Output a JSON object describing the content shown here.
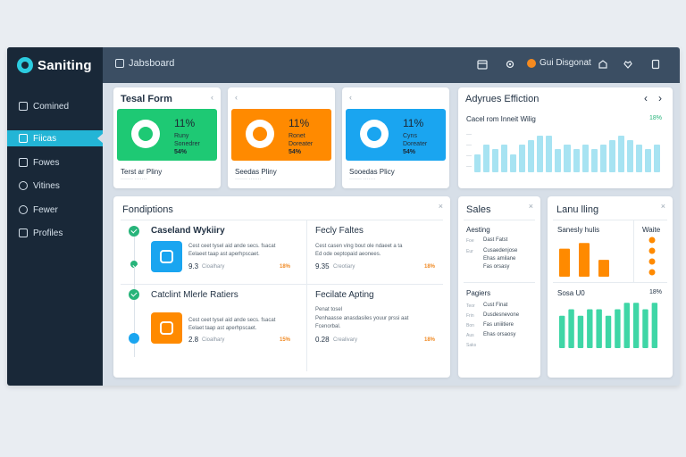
{
  "app": {
    "name": "Saniting"
  },
  "header": {
    "breadcrumb": "Jabsboard",
    "user": "Gui Disgonat"
  },
  "icons": {
    "brand": "logo-icon",
    "breadcrumb": "dashboard-icon",
    "topbar": [
      "calendar-icon",
      "settings-icon",
      "user-icon",
      "share-icon",
      "heart-icon",
      "download-icon"
    ]
  },
  "colors": {
    "accent": "#23b5d6",
    "green": "#1ec974",
    "orange": "#ff8a00",
    "blue": "#1aa5f0",
    "bar": "#a7e3f2",
    "bar_green": "#3fd6a6"
  },
  "sidebar": {
    "items": [
      {
        "label": "Comined",
        "icon": "lock-icon"
      },
      {
        "label": "Fiicas",
        "icon": "card-icon",
        "active": true
      },
      {
        "label": "Fowes",
        "icon": "calendar-icon"
      },
      {
        "label": "Vitines",
        "icon": "globe-icon"
      },
      {
        "label": "Fewer",
        "icon": "search-icon"
      },
      {
        "label": "Profiles",
        "icon": "list-icon"
      }
    ]
  },
  "stat_cards": [
    {
      "title": "Tesal Form",
      "nav": "‹",
      "value": "11%",
      "line1": "Runy",
      "line2": "Sonedrer",
      "pct": "54%",
      "foot": "Terst ar Pliny",
      "foot2": "·······  ·······"
    },
    {
      "title": "",
      "nav": "‹",
      "value": "11%",
      "line1": "Ronet",
      "line2": "Doreater",
      "pct": "54%",
      "foot": "Seedas Pliny",
      "foot2": "·······  ·······"
    },
    {
      "title": "",
      "nav": "‹",
      "value": "11%",
      "line1": "Cyns",
      "line2": "Doreater",
      "pct": "54%",
      "foot": "Sooedas Plicy",
      "foot2": "·······  ·······"
    }
  ],
  "efficiency": {
    "title": "Adyrues Effiction",
    "subtitle": "Cacel rom Inneit Wilig",
    "badge": "18%",
    "prev": "‹",
    "next": "›",
    "chart_data": {
      "type": "bar",
      "values": [
        4,
        6,
        5,
        6,
        4,
        6,
        7,
        8,
        8,
        5,
        6,
        5,
        6,
        5,
        6,
        7,
        8,
        7,
        6,
        5,
        6
      ],
      "ylim": [
        0,
        9
      ],
      "grid": false
    }
  },
  "products": {
    "title": "Fondiptions",
    "items": [
      {
        "name": "Caseland Wykiiry",
        "desc": [
          "Cest ceet tysel aid ande secs. fsacat",
          "Eelaeet taap ast aperhpscaet."
        ],
        "num": "9.3",
        "cat": "Cioalhary",
        "pct": "18%"
      },
      {
        "name": "Fecly Faltes",
        "desc": [
          "Cest casen ving bout ole ndaeet a ta",
          "Ed ode oeptopaid aeonees."
        ],
        "num": "9.35",
        "cat": "Creotiary",
        "pct": "18%"
      },
      {
        "name": "Catclint Mlerle Ratiers",
        "desc": [
          "Cest ceet tysel aid ande secs. fsacat",
          "Eelaet taap ast aperhpscaet."
        ],
        "num": "2.8",
        "cat": "Cioalhary",
        "pct": "15%"
      },
      {
        "name": "Fecilate Apting",
        "desc": [
          "Penat tosel",
          "Penhaasse anasdasiles youur prssi aat",
          "Fcenorbal."
        ],
        "num": "0.28",
        "cat": "Crealivary",
        "pct": "18%"
      }
    ]
  },
  "sales": {
    "title": "Sales",
    "section1": {
      "title": "Aesting",
      "rows": [
        {
          "key": "Foe",
          "text": "Dast Fatst"
        },
        {
          "key": "Eur",
          "text": "Cusaedenjose"
        },
        {
          "key": "",
          "text": "Ehas amilane"
        },
        {
          "key": "",
          "text": "Fas orsasy"
        }
      ]
    },
    "section2": {
      "title": "Pagiers",
      "rows": [
        {
          "key": "Teor",
          "text": "Cust Finat"
        },
        {
          "key": "Frin",
          "text": "Dusdesnevone"
        },
        {
          "key": "Bon",
          "text": "Fas uniiitiere"
        },
        {
          "key": "Aus",
          "text": "Ehas orsaosy"
        },
        {
          "key": "Saks",
          "text": ""
        }
      ]
    }
  },
  "loading": {
    "title": "Lanu lling",
    "sub1": "Sanesly hulis",
    "sub2": "Waite",
    "sub3": "Sosa U0",
    "badge": "18%",
    "chart1": {
      "type": "bar",
      "values": [
        5,
        6,
        3
      ],
      "ylim": [
        0,
        7
      ]
    },
    "dots": [
      1,
      1,
      1,
      1
    ],
    "chart2": {
      "type": "bar",
      "values": [
        5,
        6,
        5,
        6,
        6,
        5,
        6,
        7,
        7,
        6,
        7
      ],
      "ylim": [
        0,
        8
      ]
    }
  }
}
